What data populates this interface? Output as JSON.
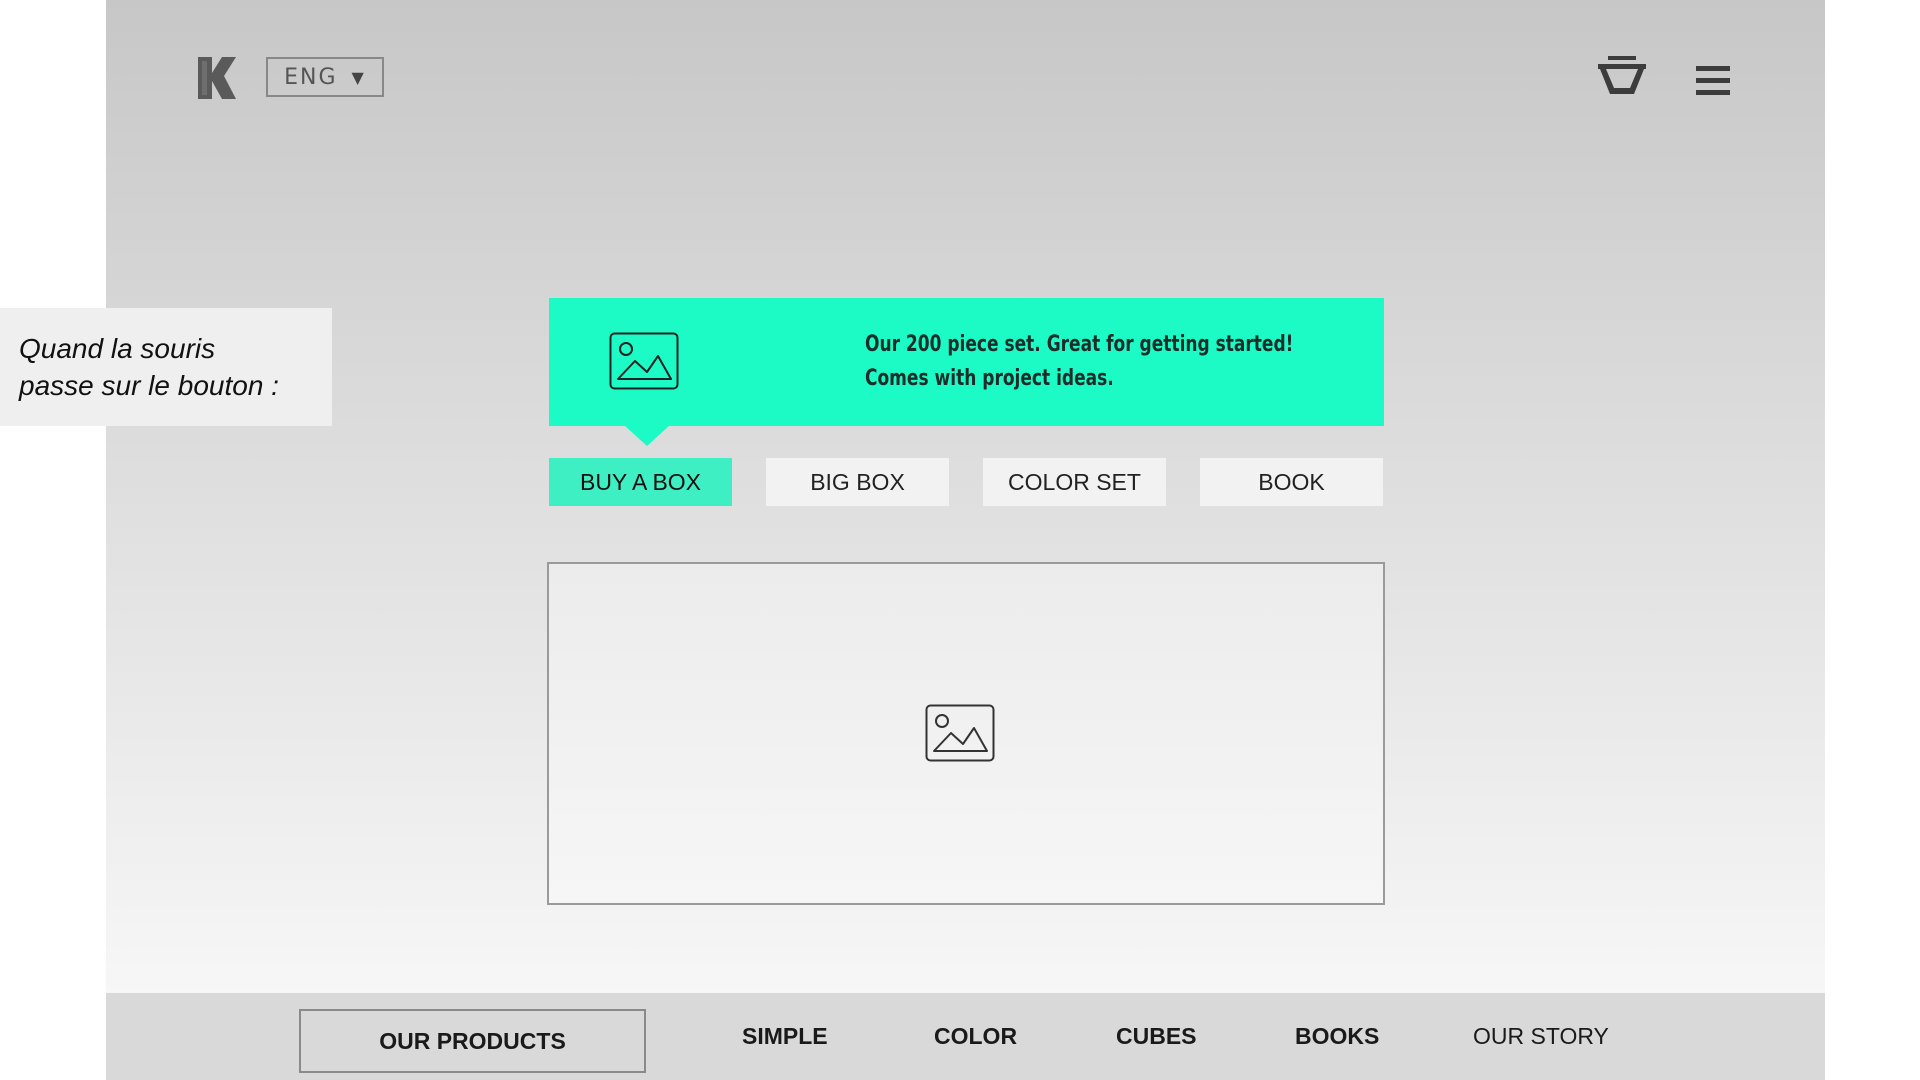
{
  "header": {
    "logo_icon": "k-logo-icon",
    "language": {
      "value": "ENG",
      "caret": "▼"
    },
    "basket_icon": "basket-icon",
    "menu_icon": "hamburger-menu-icon"
  },
  "tooltip": {
    "icon": "image-placeholder-icon",
    "line1": "Our 200 piece set. Great for getting started!",
    "line2": "Comes with project ideas.",
    "color": "#1cfbc6"
  },
  "tabs": [
    {
      "label": "BUY A BOX",
      "active": true
    },
    {
      "label": "BIG BOX",
      "active": false
    },
    {
      "label": "COLOR SET",
      "active": false
    },
    {
      "label": "BOOK",
      "active": false
    }
  ],
  "content": {
    "image_icon": "image-placeholder-icon"
  },
  "bottom_nav": {
    "items": [
      {
        "label": "OUR PRODUCTS",
        "selected": true
      },
      {
        "label": "SIMPLE"
      },
      {
        "label": "COLOR"
      },
      {
        "label": "CUBES"
      },
      {
        "label": "BOOKS"
      },
      {
        "label": "OUR STORY"
      }
    ]
  },
  "annotation": {
    "line1": "Quand la souris",
    "line2": "passe sur le bouton :"
  },
  "colors": {
    "accent": "#1cfbc6",
    "active_tab": "#3fefc4"
  }
}
